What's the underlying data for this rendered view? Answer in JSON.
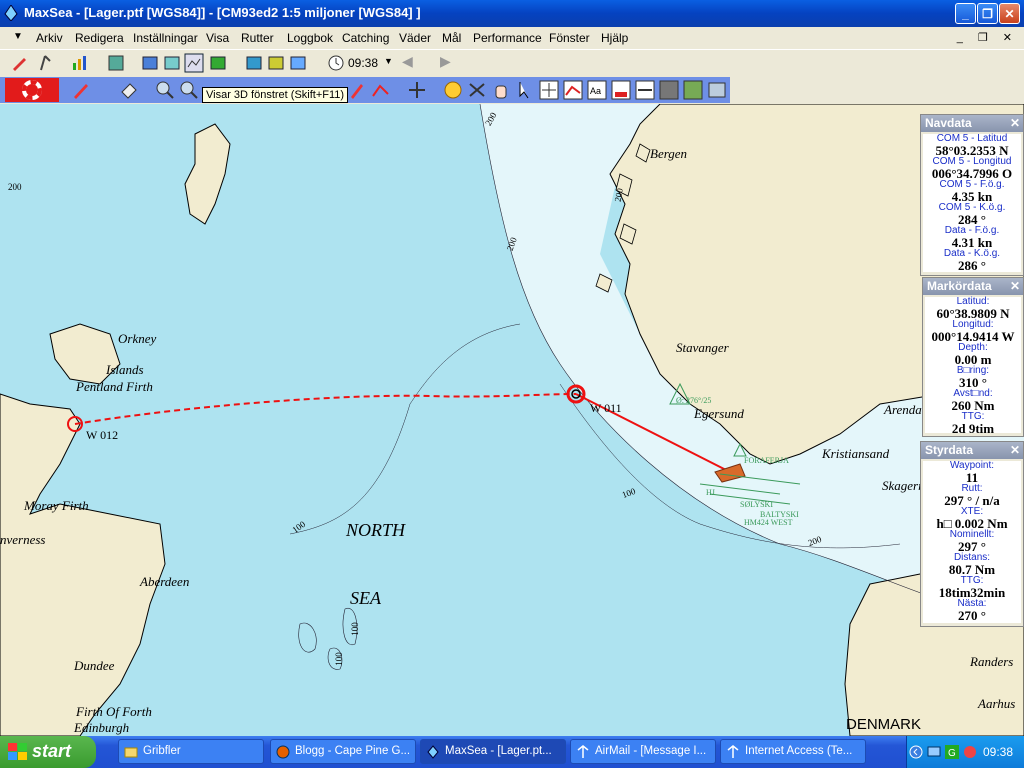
{
  "window": {
    "title": "MaxSea - [Lager.ptf [WGS84]] - [CM93ed2  1:5 miljoner [WGS84] ]",
    "minimize": "_",
    "maximize": "❐",
    "close": "✕"
  },
  "menu": [
    "Arkiv",
    "Redigera",
    "Inställningar",
    "Visa",
    "Rutter",
    "Loggbok",
    "Catching",
    "Väder",
    "Mål",
    "Performance",
    "Fönster",
    "Hjälp"
  ],
  "menu_right": "_ ❐ ✕",
  "toolbar": {
    "time": "09:38"
  },
  "tooltip": "Visar 3D fönstret (Skift+F11)",
  "map": {
    "places": {
      "orkney": "Orkney",
      "islands": "Islands",
      "pentland": "Pentland Firth",
      "moray": "Moray Firth",
      "inverness": "nverness",
      "aberdeen": "Aberdeen",
      "dundee": "Dundee",
      "forth": "Firth Of Forth",
      "edinburgh": "Edinburgh",
      "north": "NORTH",
      "sea": "SEA",
      "bergen": "Bergen",
      "stavanger": "Stavanger",
      "egersund": "Egersund",
      "arendal": "Arendal",
      "kristiansand": "Kristiansand",
      "skagerrak": "Skagerr",
      "randers": "Randers",
      "aarhus": "Aarhus",
      "denmark": "DENMARK"
    },
    "waypoints": {
      "w012": "W 012",
      "w011": "W 011"
    },
    "depth": [
      "200",
      "200",
      "200",
      "200",
      "100",
      "100",
      "200",
      "100",
      "100"
    ],
    "lines": [
      "Ø: 276°/25",
      "FORAFERJA",
      "HJ",
      "SØLYSKI",
      "BALTYSKI",
      "HM424 WEST"
    ]
  },
  "panels": {
    "navdata": {
      "title": "Navdata",
      "close": "✕",
      "rows": [
        {
          "label": "COM 5 - Latitud",
          "value": "58°03.2353 N"
        },
        {
          "label": "COM 5 - Longitud",
          "value": "006°34.7996 O"
        },
        {
          "label": "COM 5 - F.ö.g.",
          "value": "4.35 kn"
        },
        {
          "label": "COM 5 - K.ö.g.",
          "value": "284 °"
        },
        {
          "label": "Data - F.ö.g.",
          "value": "4.31 kn"
        },
        {
          "label": "Data - K.ö.g.",
          "value": "286 °"
        }
      ]
    },
    "markordata": {
      "title": "Markördata",
      "close": "✕",
      "rows": [
        {
          "label": "Latitud:",
          "value": "60°38.9809 N"
        },
        {
          "label": "Longitud:",
          "value": "000°14.9414 W"
        },
        {
          "label": "Depth:",
          "value": "0.00 m"
        },
        {
          "label": "B□ring:",
          "value": "310 °"
        },
        {
          "label": "Avst□nd:",
          "value": "260 Nm"
        },
        {
          "label": "TTG:",
          "value": "2d 9tim"
        }
      ]
    },
    "styrdata": {
      "title": "Styrdata",
      "close": "✕",
      "rows": [
        {
          "label": "Waypoint:",
          "value": "11"
        },
        {
          "label": "Rutt:",
          "value": "297 ° / n/a"
        },
        {
          "label": "XTE:",
          "value": "h□ 0.002 Nm"
        },
        {
          "label": "Nominellt:",
          "value": "297 °"
        },
        {
          "label": "Distans:",
          "value": "80.7 Nm"
        },
        {
          "label": "TTG:",
          "value": "18tim32min"
        },
        {
          "label": "Nästa:",
          "value": "270 °"
        }
      ]
    }
  },
  "taskbar": {
    "start": "start",
    "tasks": [
      {
        "label": "Gribfler",
        "icon": "folder-icon"
      },
      {
        "label": "Blogg - Cape Pine G...",
        "icon": "firefox-icon"
      },
      {
        "label": "MaxSea - [Lager.pt...",
        "icon": "maxsea-icon"
      },
      {
        "label": "AirMail - [Message I...",
        "icon": "airmail-icon"
      },
      {
        "label": "Internet Access (Te...",
        "icon": "airmail-icon"
      }
    ],
    "clock": "09:38"
  }
}
